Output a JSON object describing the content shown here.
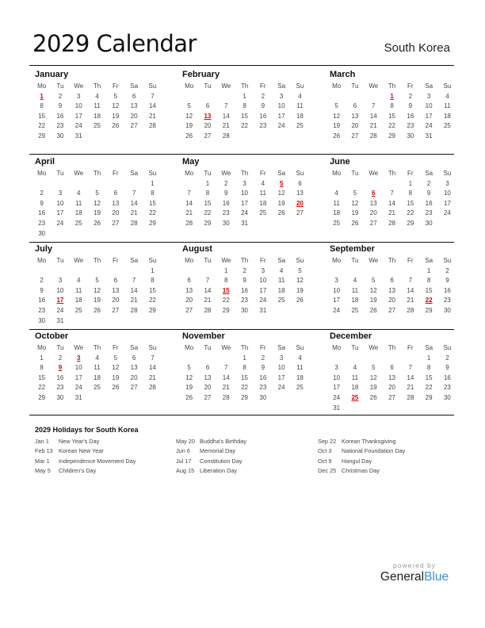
{
  "header": {
    "title": "2029 Calendar",
    "country": "South Korea"
  },
  "weekdays": [
    "Mo",
    "Tu",
    "We",
    "Th",
    "Fr",
    "Sa",
    "Su"
  ],
  "accent_color": "#e00000",
  "months": [
    {
      "name": "January",
      "offset": 0,
      "days": 31,
      "holidays": [
        1
      ]
    },
    {
      "name": "February",
      "offset": 3,
      "days": 28,
      "holidays": [
        13
      ]
    },
    {
      "name": "March",
      "offset": 3,
      "days": 31,
      "holidays": [
        1
      ]
    },
    {
      "name": "April",
      "offset": 6,
      "days": 30,
      "holidays": []
    },
    {
      "name": "May",
      "offset": 1,
      "days": 31,
      "holidays": [
        5,
        20
      ]
    },
    {
      "name": "June",
      "offset": 4,
      "days": 30,
      "holidays": [
        6
      ]
    },
    {
      "name": "July",
      "offset": 6,
      "days": 31,
      "holidays": [
        17
      ]
    },
    {
      "name": "August",
      "offset": 2,
      "days": 31,
      "holidays": [
        15
      ]
    },
    {
      "name": "September",
      "offset": 5,
      "days": 30,
      "holidays": [
        22
      ]
    },
    {
      "name": "October",
      "offset": 0,
      "days": 31,
      "holidays": [
        3,
        9
      ]
    },
    {
      "name": "November",
      "offset": 3,
      "days": 30,
      "holidays": []
    },
    {
      "name": "December",
      "offset": 5,
      "days": 31,
      "holidays": [
        25
      ]
    }
  ],
  "holidays_section": {
    "title": "2029 Holidays for South Korea",
    "columns": [
      [
        {
          "date": "Jan 1",
          "name": "New Year's Day"
        },
        {
          "date": "Feb 13",
          "name": "Korean New Year"
        },
        {
          "date": "Mar 1",
          "name": "Independence Movement Day"
        },
        {
          "date": "May 5",
          "name": "Children's Day"
        }
      ],
      [
        {
          "date": "May 20",
          "name": "Buddha's Birthday"
        },
        {
          "date": "Jun 6",
          "name": "Memorial Day"
        },
        {
          "date": "Jul 17",
          "name": "Constitution Day"
        },
        {
          "date": "Aug 15",
          "name": "Liberation Day"
        }
      ],
      [
        {
          "date": "Sep 22",
          "name": "Korean Thanksgiving"
        },
        {
          "date": "Oct 3",
          "name": "National Foundation Day"
        },
        {
          "date": "Oct 9",
          "name": "Hangul Day"
        },
        {
          "date": "Dec 25",
          "name": "Christmas Day"
        }
      ]
    ]
  },
  "branding": {
    "powered_by": "powered by",
    "brand_dark": "General",
    "brand_blue": "Blue"
  }
}
